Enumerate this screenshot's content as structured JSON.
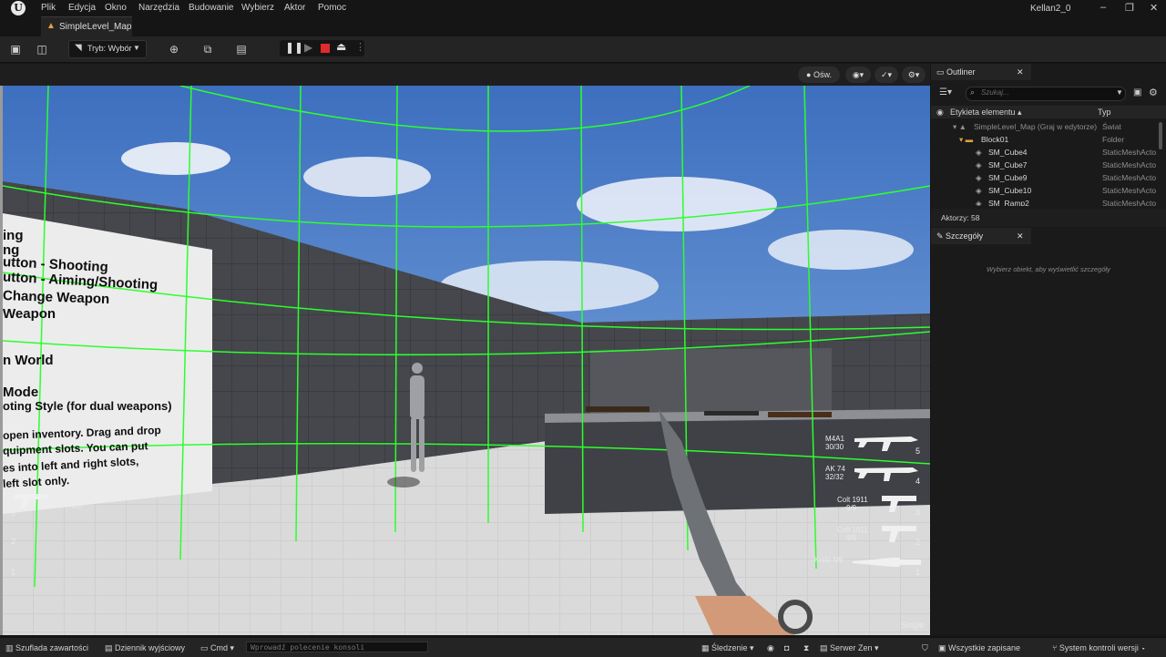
{
  "menu": {
    "items": [
      "Plik",
      "Edycja",
      "Okno",
      "Narzędzia",
      "Budowanie",
      "Wybierz",
      "Aktor",
      "Pomoc"
    ],
    "user": "Kellan2_0"
  },
  "document_tab": {
    "label": "SimpleLevel_Map"
  },
  "toolbar": {
    "mode_label": "Tryb: Wybór"
  },
  "viewport": {
    "lighting_label": "Ośw.",
    "board_lines": [
      "ing",
      "ng",
      "utton - Shooting",
      "utton - Aiming/Shooting",
      "Change Weapon",
      "Weapon",
      "",
      "n World",
      "",
      "Mode",
      "oting Style (for dual weapons)",
      "",
      "open inventory. Drag and drop",
      "quipment slots. You can put",
      "es into left and right slots,",
      "left slot only."
    ],
    "left_weapon": {
      "name": "Colt 1911",
      "ammo": "9/9",
      "slot": "3"
    },
    "slot_numbers": [
      "2",
      "1"
    ],
    "weapons": [
      {
        "name": "M4A1",
        "ammo": "30/30",
        "slot": "5"
      },
      {
        "name": "AK 74",
        "ammo": "32/32",
        "slot": "4"
      },
      {
        "name": "Colt 1911",
        "ammo": "9/9",
        "slot": "3"
      },
      {
        "name": "Colt 1911",
        "ammo": "9/9",
        "slot": "2"
      },
      {
        "name": "Knife M9",
        "ammo": "",
        "slot": "1"
      }
    ],
    "fire_mode": "Single"
  },
  "outliner": {
    "tab_label": "Outliner",
    "search_placeholder": "Szukaj...",
    "col_label": "Etykieta elementu",
    "col_type": "Typ",
    "rows": [
      {
        "label": "SimpleLevel_Map (Graj w edytorze)",
        "type": "Świat",
        "indent": 0
      },
      {
        "label": "Block01",
        "type": "Folder",
        "indent": 1
      },
      {
        "label": "SM_Cube4",
        "type": "StaticMeshActo",
        "indent": 2
      },
      {
        "label": "SM_Cube7",
        "type": "StaticMeshActo",
        "indent": 2
      },
      {
        "label": "SM_Cube9",
        "type": "StaticMeshActo",
        "indent": 2
      },
      {
        "label": "SM_Cube10",
        "type": "StaticMeshActo",
        "indent": 2
      },
      {
        "label": "SM_Ramp2",
        "type": "StaticMeshActo",
        "indent": 2
      }
    ],
    "actor_count": "Aktorzy: 58"
  },
  "details": {
    "tab_label": "Szczegóły",
    "hint": "Wybierz obiekt, aby wyświetlić szczegóły"
  },
  "statusbar": {
    "content_drawer": "Szuflada zawartości",
    "output_log": "Dziennik wyjściowy",
    "cmd": "Cmd",
    "console_placeholder": "Wprowadź polecenie konsoli",
    "trace": "Śledzenie",
    "zen_server": "Serwer Zen",
    "all_saved": "Wszystkie zapisane",
    "source_control": "System kontroli wersji"
  },
  "colors": {
    "accent_play": "#e02b2b",
    "grid_green": "#2cff2c",
    "sky": "#5b8fd6"
  }
}
